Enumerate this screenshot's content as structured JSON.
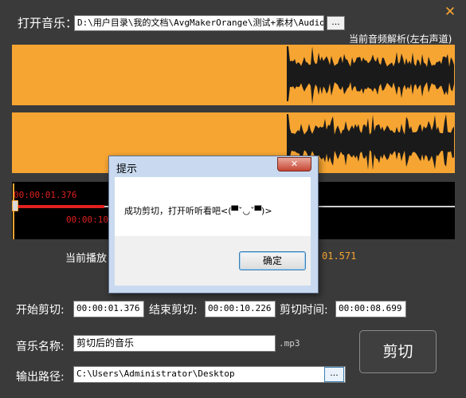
{
  "window": {
    "close_glyph": "✕"
  },
  "open_music": {
    "label": "打开音乐：",
    "path_value": "D:\\用户目录\\我的文档\\AvgMakerOrange\\测试+素材\\Audio\\",
    "browse_label": "..."
  },
  "analysis_label": "当前音频解析(左右声道)",
  "timeline": {
    "start_time": "00:00:01.376",
    "end_time": "00:00:10",
    "current_prefix": "当前播放",
    "current_suffix": "01.571"
  },
  "clip": {
    "start_label": "开始剪切:",
    "start_value": "00:00:01.376",
    "end_label": "结束剪切:",
    "end_value": "00:00:10.226",
    "duration_label": "剪切时间:",
    "duration_value": "00:00:08.699"
  },
  "music_name": {
    "label": "音乐名称:",
    "value": "剪切后的音乐",
    "ext": ".mp3"
  },
  "output_path": {
    "label": "输出路径:",
    "value": "C:\\Users\\Administrator\\Desktop",
    "browse_label": "..."
  },
  "cut_button": "剪切",
  "dialog": {
    "title": "提示",
    "close_glyph": "✕",
    "message": "成功剪切，打开听听看吧<(▀ˇ◡ˇ▀)>",
    "ok_label": "确定"
  },
  "colors": {
    "accent": "#f7a532",
    "background": "#3a3a3a",
    "playhead": "#e02020"
  }
}
